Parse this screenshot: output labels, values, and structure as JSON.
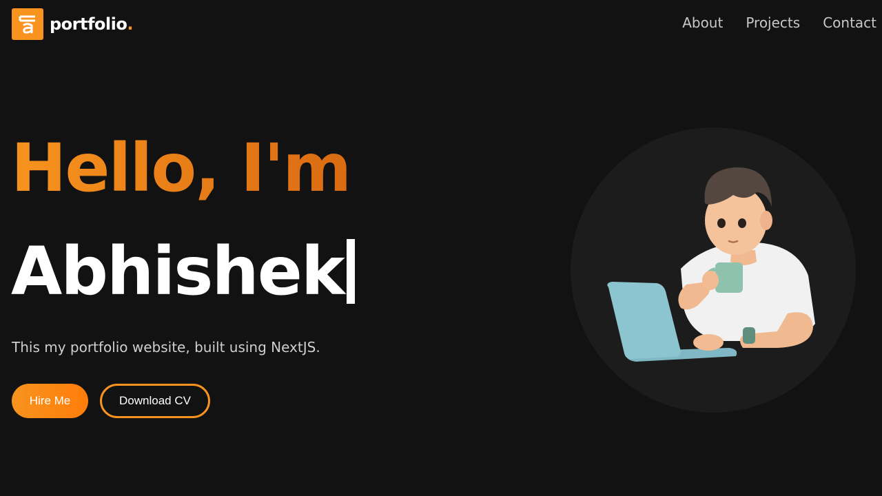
{
  "nav": {
    "logo_text": "portfolio",
    "logo_dot": ".",
    "links": [
      {
        "label": "About"
      },
      {
        "label": "Projects"
      },
      {
        "label": "Contact"
      }
    ]
  },
  "hero": {
    "greeting": "Hello, I'm",
    "name": "Abhishek",
    "subtitle": "This my portfolio website, built using NextJS.",
    "primary_button": "Hire Me",
    "secondary_button": "Download CV"
  },
  "colors": {
    "background": "#121212",
    "accent": "#f7931e",
    "circle": "#1c1c1c",
    "laptop": "#8cc5d0"
  },
  "icons": {
    "logo": "logo-mark-icon",
    "illustration": "developer-with-laptop-illustration"
  }
}
